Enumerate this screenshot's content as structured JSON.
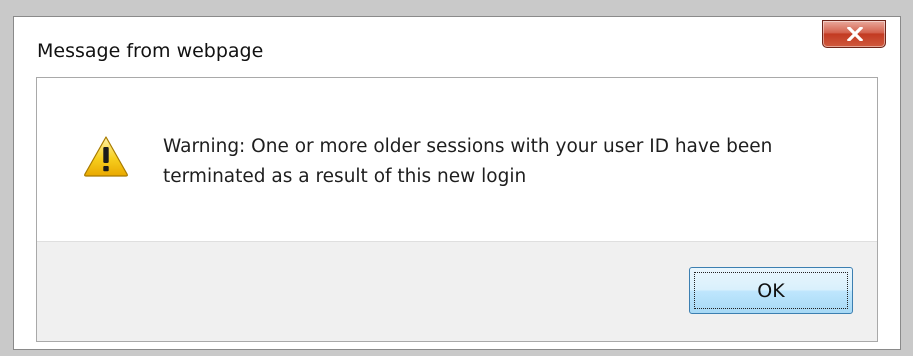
{
  "dialog": {
    "title": "Message from webpage",
    "close_icon": "close-x-icon",
    "icon": "warning-icon",
    "message_line1": "Warning: One or more older sessions with your user ID have been",
    "message_line2": "terminated as a result of this new login",
    "ok_label": "OK"
  },
  "colors": {
    "close_button": "#c9452c",
    "warning_yellow": "#f5c400",
    "ok_border": "#3c7fb1",
    "footer_bg": "#f0f0f0"
  }
}
